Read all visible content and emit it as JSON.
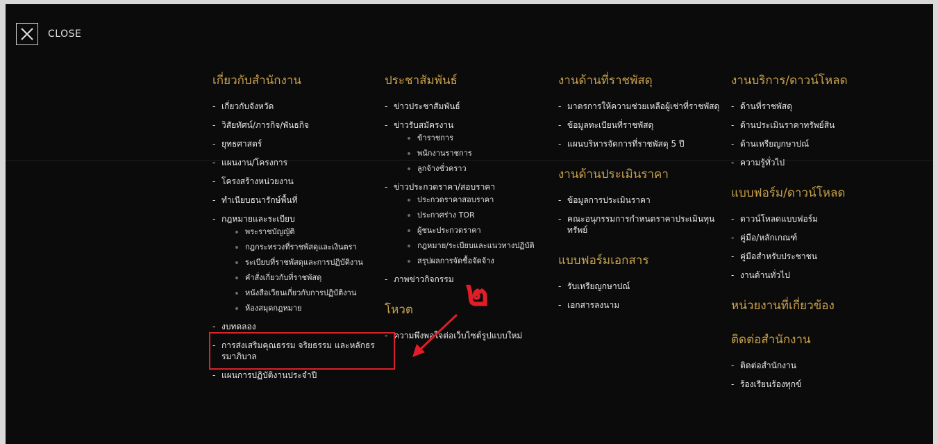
{
  "close": {
    "label": "CLOSE"
  },
  "columns": [
    {
      "sections": [
        {
          "title": "เกี่ยวกับสำนักงาน",
          "items": [
            {
              "label": "เกี่ยวกับจังหวัด"
            },
            {
              "label": "วิสัยทัศน์/ภารกิจ/พันธกิจ"
            },
            {
              "label": "ยุทธศาสตร์"
            },
            {
              "label": "แผนงาน/โครงการ"
            },
            {
              "label": "โครงสร้างหน่วยงาน"
            },
            {
              "label": "ทำเนียบธนารักษ์พื้นที่"
            },
            {
              "label": "กฎหมายและระเบียบ",
              "children": [
                "พระราชบัญญัติ",
                "กฎกระทรวงที่ราชพัสดุและเงินตรา",
                "ระเบียบที่ราชพัสดุและการปฏิบัติงาน",
                "คำสั่งเกี่ยวกับที่ราชพัสดุ",
                "หนังสือเวียนเกี่ยวกับการปฏิบัติงาน",
                "ห้องสมุดกฎหมาย"
              ]
            },
            {
              "label": "งบทดลอง"
            },
            {
              "label": "การส่งเสริมคุณธรรม จริยธรรม และหลักธรรมาภิบาล"
            },
            {
              "label": "แผนการปฏิบัติงานประจำปี"
            }
          ]
        }
      ]
    },
    {
      "sections": [
        {
          "title": "ประชาสัมพันธ์",
          "items": [
            {
              "label": "ข่าวประชาสัมพันธ์"
            },
            {
              "label": "ข่าวรับสมัครงาน",
              "children": [
                "ข้าราชการ",
                "พนักงานราชการ",
                "ลูกจ้างชั่วคราว"
              ]
            },
            {
              "label": "ข่าวประกวดราคา/สอบราคา",
              "children": [
                "ประกวดราคาสอบราคา",
                "ประกาศร่าง TOR",
                "ผู้ชนะประกวดราคา",
                "กฎหมาย/ระเบียบและแนวทางปฏิบัติ",
                "สรุปผลการจัดซื้อจัดจ้าง"
              ]
            },
            {
              "label": "ภาพข่าวกิจกรรม"
            }
          ]
        },
        {
          "title": "โหวต",
          "items": [
            {
              "label": "ความพึงพอใจต่อเว็บไซต์รูปแบบใหม่"
            }
          ]
        }
      ]
    },
    {
      "sections": [
        {
          "title": "งานด้านที่ราชพัสดุ",
          "items": [
            {
              "label": "มาตรการให้ความช่วยเหลือผู้เช่าที่ราชพัสดุ"
            },
            {
              "label": "ข้อมูลทะเบียนที่ราชพัสดุ"
            },
            {
              "label": "แผนบริหารจัดการที่ราชพัสดุ 5 ปี"
            }
          ]
        },
        {
          "title": "งานด้านประเมินราคา",
          "items": [
            {
              "label": "ข้อมูลการประเมินราคา"
            },
            {
              "label": "คณะอนุกรรมการกำหนดราคาประเมินทุนทรัพย์"
            }
          ]
        },
        {
          "title": "แบบฟอร์มเอกสาร",
          "items": [
            {
              "label": "รับเหรียญกษาปณ์"
            },
            {
              "label": "เอกสารลงนาม"
            }
          ]
        }
      ]
    },
    {
      "sections": [
        {
          "title": "งานบริการ/ดาวน์โหลด",
          "items": [
            {
              "label": "ด้านที่ราชพัสดุ"
            },
            {
              "label": "ด้านประเมินราคาทรัพย์สิน"
            },
            {
              "label": "ด้านเหรียญกษาปณ์"
            },
            {
              "label": "ความรู้ทั่วไป"
            }
          ]
        },
        {
          "title": "แบบฟอร์ม/ดาวน์โหลด",
          "items": [
            {
              "label": "ดาวน์โหลดแบบฟอร์ม"
            },
            {
              "label": "คู่มือ/หลักเกณฑ์"
            },
            {
              "label": "คู่มือสำหรับประชาชน"
            },
            {
              "label": "งานด้านทั่วไป"
            }
          ]
        },
        {
          "title": "หน่วยงานที่เกี่ยวข้อง",
          "items": []
        },
        {
          "title": "ติดต่อสำนักงาน",
          "items": [
            {
              "label": "ติดต่อสำนักงาน"
            },
            {
              "label": "ร้องเรียนร้องทุกข์"
            }
          ]
        }
      ]
    }
  ],
  "annotation": {
    "number": "๒",
    "color": "#e11d27"
  },
  "colors": {
    "heading": "#c9a14a",
    "background": "#0b0b0b",
    "highlight": "#d8232a"
  }
}
